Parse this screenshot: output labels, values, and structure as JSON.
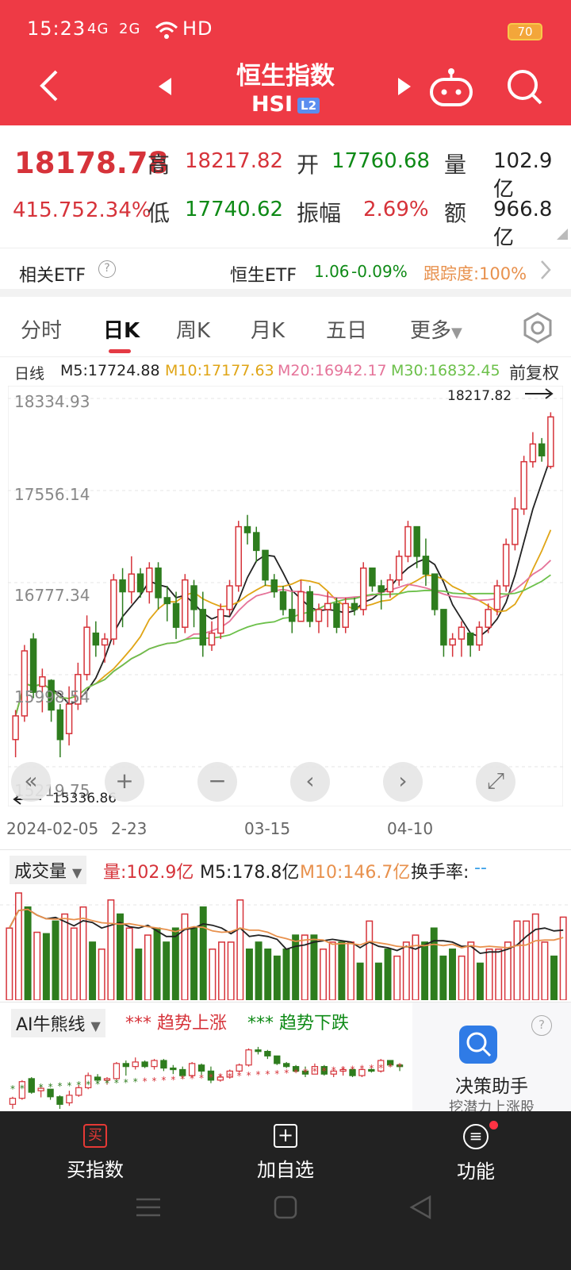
{
  "status_bar": {
    "time": "15:23",
    "net": "4G",
    "net2": "2G",
    "hd": "HD",
    "battery": "70"
  },
  "header": {
    "title": "恒生指数",
    "subtitle": "HSI",
    "badge": "L2"
  },
  "quote": {
    "price": "18178.78",
    "change": "415.75",
    "change_pct": "2.34%",
    "high_label": "高",
    "high": "18217.82",
    "open_label": "开",
    "open": "17760.68",
    "vol_label": "量",
    "vol": "102.9亿",
    "low_label": "低",
    "low": "17740.62",
    "amp_label": "振幅",
    "amp": "2.69%",
    "amt_label": "额",
    "amt": "966.8亿"
  },
  "etf": {
    "label": "相关ETF",
    "name": "恒生ETF",
    "price": "1.06",
    "change": "-0.09%",
    "track": "跟踪度:100%"
  },
  "tabs": [
    "分时",
    "日K",
    "周K",
    "月K",
    "五日",
    "更多"
  ],
  "ma_legend": {
    "period": "日线",
    "m5": "M5:17724.88",
    "m10": "M10:17177.63",
    "m20": "M20:16942.17",
    "m30": "M30:16832.45",
    "adj": "前复权"
  },
  "colors": {
    "up": "#d6333a",
    "down": "#2e7d1e",
    "m5": "#222222",
    "m10": "#e0a516",
    "m20": "#e57399",
    "m30": "#6cc04a",
    "brand": "#ee3a45"
  },
  "chart_data": {
    "type": "candlestick",
    "price_axis": [
      "18334.93",
      "17556.14",
      "16777.34",
      "15998.54",
      "15219.75"
    ],
    "max_label": "18217.82",
    "min_label": "15336.86",
    "x_ticks": [
      "2024-02-05",
      "2-23",
      "03-15",
      "04-10"
    ],
    "ohlc": [
      [
        15450,
        15700,
        15300,
        15650
      ],
      [
        15650,
        16250,
        15600,
        16200
      ],
      [
        16300,
        16350,
        15800,
        15850
      ],
      [
        15900,
        16050,
        15680,
        15980
      ],
      [
        15950,
        15960,
        15600,
        15700
      ],
      [
        15700,
        15750,
        15300,
        15450
      ],
      [
        15500,
        15900,
        15400,
        15750
      ],
      [
        15750,
        16100,
        15700,
        16000
      ],
      [
        16000,
        16500,
        15950,
        16400
      ],
      [
        16350,
        16450,
        16150,
        16250
      ],
      [
        16250,
        16350,
        16100,
        16300
      ],
      [
        16300,
        16850,
        16250,
        16800
      ],
      [
        16800,
        16900,
        16400,
        16700
      ],
      [
        16700,
        17000,
        16600,
        16850
      ],
      [
        16850,
        16900,
        16650,
        16700
      ],
      [
        16700,
        16950,
        16600,
        16900
      ],
      [
        16900,
        16950,
        16550,
        16650
      ],
      [
        16650,
        16750,
        16450,
        16600
      ],
      [
        16600,
        16700,
        16300,
        16400
      ],
      [
        16400,
        16850,
        16350,
        16800
      ],
      [
        16750,
        16800,
        16400,
        16550
      ],
      [
        16550,
        16700,
        16150,
        16250
      ],
      [
        16250,
        16450,
        16200,
        16350
      ],
      [
        16350,
        16600,
        16300,
        16550
      ],
      [
        16550,
        16800,
        16500,
        16750
      ],
      [
        16750,
        17300,
        16700,
        17250
      ],
      [
        17250,
        17350,
        17100,
        17200
      ],
      [
        17200,
        17250,
        16950,
        17050
      ],
      [
        17050,
        17000,
        16750,
        16800
      ],
      [
        16800,
        16850,
        16650,
        16700
      ],
      [
        16700,
        16750,
        16500,
        16550
      ],
      [
        16550,
        16700,
        16350,
        16450
      ],
      [
        16450,
        16800,
        16450,
        16700
      ],
      [
        16700,
        16750,
        16400,
        16450
      ],
      [
        16450,
        16600,
        16350,
        16550
      ],
      [
        16550,
        16700,
        16400,
        16600
      ],
      [
        16600,
        16650,
        16350,
        16400
      ],
      [
        16400,
        16650,
        16350,
        16600
      ],
      [
        16600,
        16650,
        16500,
        16550
      ],
      [
        16550,
        16950,
        16500,
        16900
      ],
      [
        16900,
        16850,
        16700,
        16750
      ],
      [
        16750,
        16800,
        16550,
        16700
      ],
      [
        16700,
        16850,
        16650,
        16800
      ],
      [
        16800,
        17050,
        16750,
        17000
      ],
      [
        17000,
        17300,
        16950,
        17250
      ],
      [
        17250,
        17200,
        16900,
        17000
      ],
      [
        17000,
        17150,
        16750,
        16850
      ],
      [
        16850,
        16700,
        16500,
        16550
      ],
      [
        16550,
        16400,
        16150,
        16250
      ],
      [
        16250,
        16350,
        16150,
        16300
      ],
      [
        16300,
        16450,
        16150,
        16400
      ],
      [
        16350,
        16300,
        16150,
        16250
      ],
      [
        16250,
        16450,
        16200,
        16400
      ],
      [
        16400,
        16600,
        16350,
        16550
      ],
      [
        16550,
        16800,
        16500,
        16750
      ],
      [
        16750,
        17150,
        16700,
        17100
      ],
      [
        17100,
        17500,
        17050,
        17400
      ],
      [
        17400,
        17850,
        17350,
        17800
      ],
      [
        17800,
        18050,
        17750,
        17950
      ],
      [
        17950,
        18000,
        17800,
        17850
      ],
      [
        17760,
        18218,
        17740,
        18179
      ]
    ],
    "ylim": [
      15219.75,
      18334.93
    ]
  },
  "controls": [
    "«",
    "+",
    "−",
    "‹",
    "›",
    "⤢"
  ],
  "volume": {
    "label": "成交量",
    "vol": "量:102.9亿",
    "m5": "M5:178.8亿",
    "m10": "M10:146.7亿",
    "turnover": "换手率:",
    "turnover_val": "--"
  },
  "ai_line": {
    "label": "AI牛熊线",
    "up": "*** 趋势上涨",
    "down": "*** 趋势下跌",
    "helper_title": "决策助手",
    "helper_sub": "挖潜力上涨股",
    "help": "?"
  },
  "bottom_nav": [
    {
      "label": "买指数",
      "icon": "buy-icon"
    },
    {
      "label": "加自选",
      "icon": "add-icon"
    },
    {
      "label": "功能",
      "icon": "menu-icon"
    }
  ]
}
